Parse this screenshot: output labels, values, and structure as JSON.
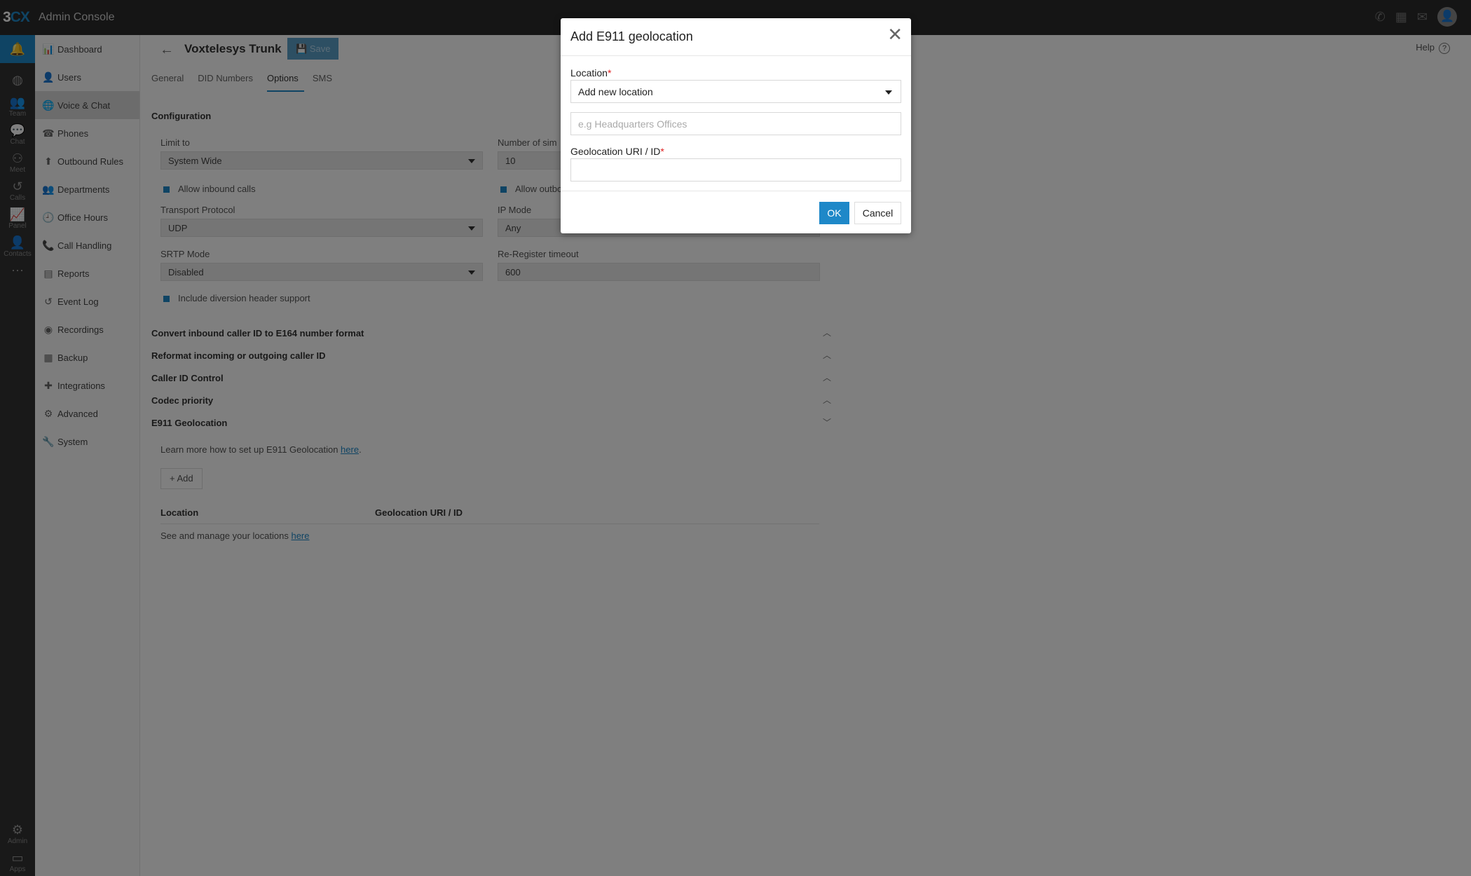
{
  "topbar": {
    "logo_a": "3",
    "logo_b": "CX",
    "title": "Admin Console"
  },
  "rail": [
    {
      "icon": "bell-icon",
      "glyph": "🔔",
      "label": ""
    },
    {
      "icon": "globe-icon",
      "glyph": "◍",
      "label": ""
    },
    {
      "icon": "team-icon",
      "glyph": "👥",
      "label": "Team"
    },
    {
      "icon": "chat-icon",
      "glyph": "💬",
      "label": "Chat"
    },
    {
      "icon": "meet-icon",
      "glyph": "⚇",
      "label": "Meet"
    },
    {
      "icon": "calls-icon",
      "glyph": "↺",
      "label": "Calls"
    },
    {
      "icon": "panel-icon",
      "glyph": "📈",
      "label": "Panel"
    },
    {
      "icon": "contacts-icon",
      "glyph": "👤",
      "label": "Contacts"
    },
    {
      "icon": "more-icon",
      "glyph": "⋯",
      "label": ""
    },
    {
      "icon": "admin-icon",
      "glyph": "⚙",
      "label": "Admin"
    },
    {
      "icon": "apps-icon",
      "glyph": "▭",
      "label": "Apps"
    }
  ],
  "sidebar": [
    {
      "label": "Dashboard",
      "glyph": "📊"
    },
    {
      "label": "Users",
      "glyph": "👤"
    },
    {
      "label": "Voice & Chat",
      "glyph": "🌐"
    },
    {
      "label": "Phones",
      "glyph": "☎"
    },
    {
      "label": "Outbound Rules",
      "glyph": "⬆"
    },
    {
      "label": "Departments",
      "glyph": "👥"
    },
    {
      "label": "Office Hours",
      "glyph": "🕘"
    },
    {
      "label": "Call Handling",
      "glyph": "📞"
    },
    {
      "label": "Reports",
      "glyph": "▤"
    },
    {
      "label": "Event Log",
      "glyph": "↺"
    },
    {
      "label": "Recordings",
      "glyph": "◉"
    },
    {
      "label": "Backup",
      "glyph": "▦"
    },
    {
      "label": "Integrations",
      "glyph": "✚"
    },
    {
      "label": "Advanced",
      "glyph": "⚙"
    },
    {
      "label": "System",
      "glyph": "🔧"
    }
  ],
  "main": {
    "title": "Voxtelesys Trunk",
    "save": "Save",
    "help": "Help",
    "tabs": [
      "General",
      "DID Numbers",
      "Options",
      "SMS"
    ],
    "configuration": "Configuration",
    "limit_to_label": "Limit to",
    "limit_to_value": "System Wide",
    "sim_label": "Number of sim",
    "sim_value": "10",
    "allow_inbound": "Allow inbound calls",
    "allow_outbound": "Allow outbo",
    "transport_label": "Transport Protocol",
    "transport_value": "UDP",
    "ipmode_label": "IP Mode",
    "ipmode_value": "Any",
    "srtp_label": "SRTP Mode",
    "srtp_value": "Disabled",
    "reregister_label": "Re-Register timeout",
    "reregister_value": "600",
    "diversion": "Include diversion header support",
    "sections": [
      "Convert inbound caller ID to E164 number format",
      "Reformat incoming or outgoing caller ID",
      "Caller ID Control",
      "Codec priority",
      "E911 Geolocation"
    ],
    "learn_text": "Learn more how to set up E911 Geolocation ",
    "learn_link": "here",
    "learn_end": ".",
    "add": "Add",
    "col_location": "Location",
    "col_geo": "Geolocation URI / ID",
    "manage_text": "See and manage your locations ",
    "manage_link": "here"
  },
  "modal": {
    "title": "Add E911 geolocation",
    "location_label": "Location",
    "location_value": "Add new location",
    "name_placeholder": "e.g Headquarters Offices",
    "geo_label": "Geolocation URI / ID",
    "required_mark": "*",
    "ok": "OK",
    "cancel": "Cancel"
  }
}
